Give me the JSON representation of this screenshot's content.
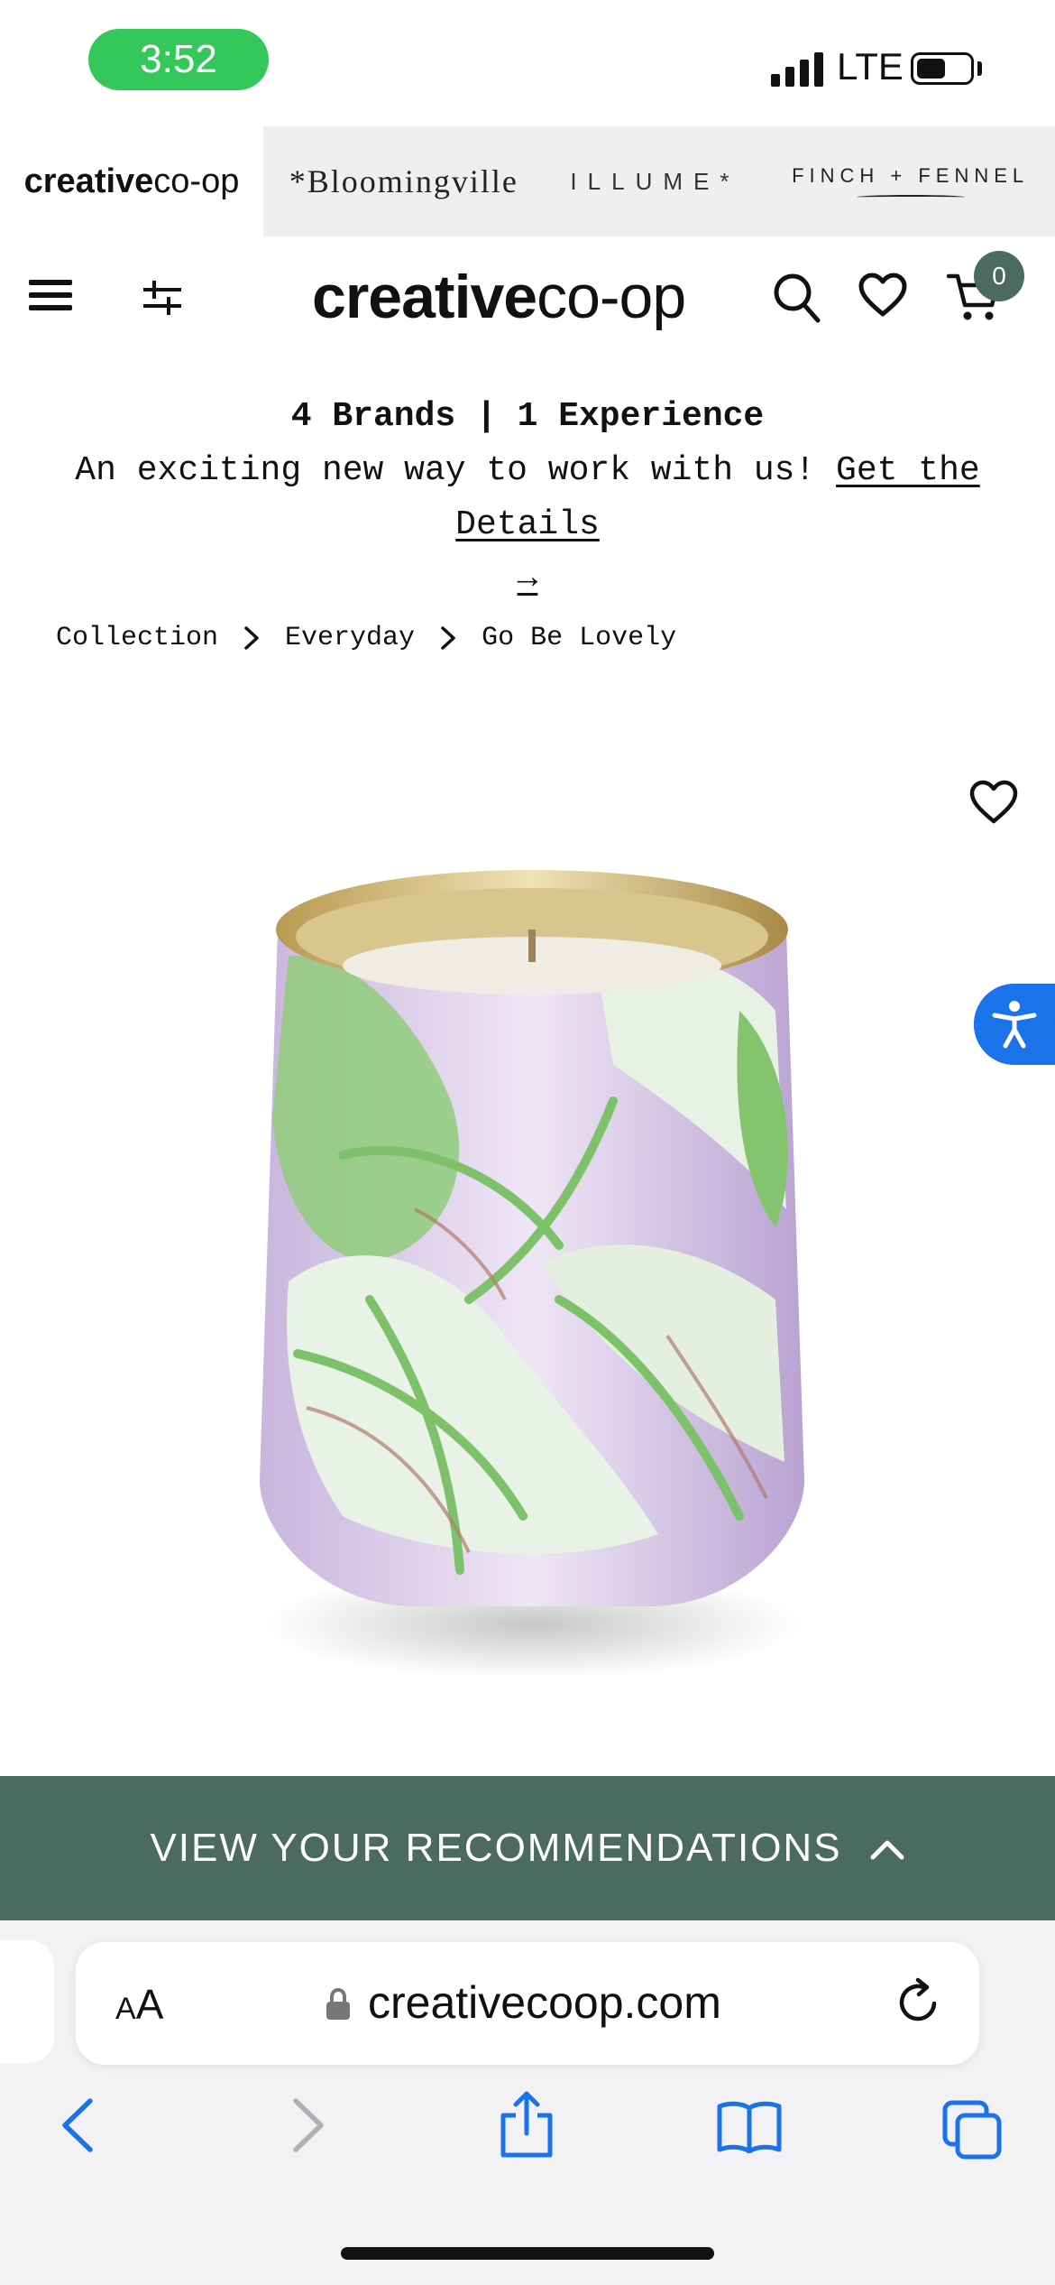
{
  "status_bar": {
    "time": "3:52",
    "network": "LTE",
    "battery_level": 0.55
  },
  "brands": {
    "creative_bold": "creative",
    "creative_light": "co-op",
    "bloomingville": "*Bloomingville",
    "illume": "ILLUME*",
    "finch": "FINCH + FENNEL"
  },
  "header": {
    "logo_bold": "creative",
    "logo_light": "co-op",
    "cart_count": "0",
    "icons": [
      "menu-icon",
      "filter-icon",
      "search-icon",
      "heart-icon",
      "cart-icon"
    ]
  },
  "promo": {
    "title": "4 Brands | 1 Experience",
    "text": "An exciting new way to work with us!",
    "link": "Get the Details",
    "arrow": "→"
  },
  "breadcrumb": [
    "Collection",
    "Everyday",
    "Go Be Lovely"
  ],
  "product": {
    "image_alt": "candle-image"
  },
  "recommendations": {
    "label": "VIEW YOUR RECOMMENDATIONS"
  },
  "browser": {
    "aa_small": "A",
    "aa_large": "A",
    "url": "creativecoop.com"
  },
  "colors": {
    "accent_green": "#4a6b5d",
    "status_green": "#34c759",
    "a11y_blue": "#1a73e8",
    "safari_blue": "#1a73e8"
  }
}
